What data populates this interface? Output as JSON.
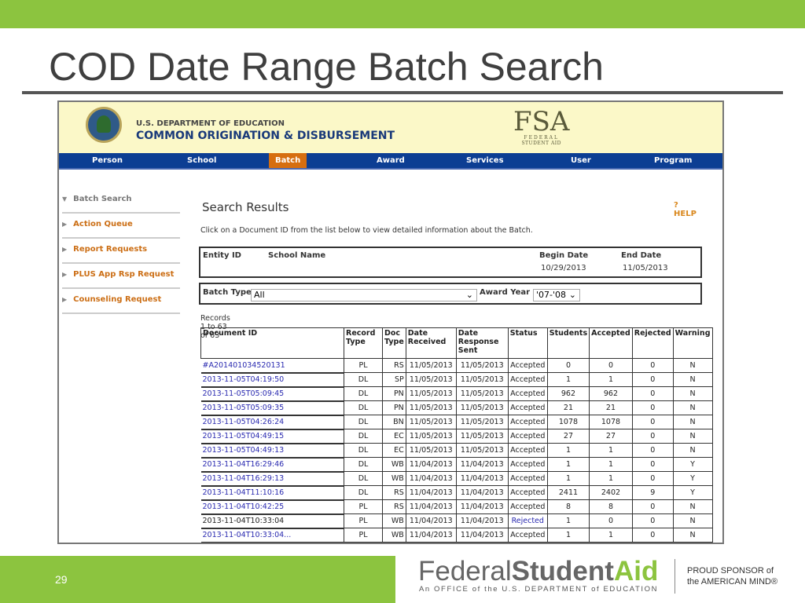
{
  "slide": {
    "title": "COD Date Range Batch Search",
    "page_number": "29",
    "colors": {
      "green": "#8cc43f",
      "nav_blue": "#0c3e93",
      "active_orange": "#d66e10"
    }
  },
  "header": {
    "dept": "U.S. DEPARTMENT OF EDUCATION",
    "system": "COMMON ORIGINATION & DISBURSEMENT",
    "fsa_logo": "FSA",
    "fsa_sub1": "FEDERAL",
    "fsa_sub2": "STUDENT AID"
  },
  "nav": [
    "Person",
    "School",
    "Batch",
    "Award",
    "Services",
    "User",
    "Program"
  ],
  "sidebar": [
    "Batch Search",
    "Action Queue",
    "Report Requests",
    "PLUS App Rsp Request",
    "Counseling Request"
  ],
  "main": {
    "heading": "Search Results",
    "help": "HELP",
    "instructions": "Click on a Document ID from the list below to view detailed information about the Batch.",
    "entity_label": "Entity ID",
    "school_label": "School Name",
    "begin_label": "Begin Date",
    "end_label": "End Date",
    "begin_date": "10/29/2013",
    "end_date": "11/05/2013",
    "batch_type_label": "Batch Type",
    "batch_type_value": "All",
    "award_year_label": "Award Year",
    "award_year_value": "'07-'08",
    "records": "Records 1 to 63 of 63"
  },
  "table": {
    "headers": [
      "Document ID",
      "Record Type",
      "Doc Type",
      "Date Received",
      "Date Response Sent",
      "Status",
      "Students",
      "Accepted",
      "Rejected",
      "Warning"
    ],
    "rows": [
      [
        "#A201401034520131",
        "PL",
        "RS",
        "11/05/2013",
        "11/05/2013",
        "Accepted",
        "0",
        "0",
        "0",
        "N"
      ],
      [
        "2013-11-05T04:19:50",
        "DL",
        "SP",
        "11/05/2013",
        "11/05/2013",
        "Accepted",
        "1",
        "1",
        "0",
        "N"
      ],
      [
        "2013-11-05T05:09:45",
        "DL",
        "PN",
        "11/05/2013",
        "11/05/2013",
        "Accepted",
        "962",
        "962",
        "0",
        "N"
      ],
      [
        "2013-11-05T05:09:35",
        "DL",
        "PN",
        "11/05/2013",
        "11/05/2013",
        "Accepted",
        "21",
        "21",
        "0",
        "N"
      ],
      [
        "2013-11-05T04:26:24",
        "DL",
        "BN",
        "11/05/2013",
        "11/05/2013",
        "Accepted",
        "1078",
        "1078",
        "0",
        "N"
      ],
      [
        "2013-11-05T04:49:15",
        "DL",
        "EC",
        "11/05/2013",
        "11/05/2013",
        "Accepted",
        "27",
        "27",
        "0",
        "N"
      ],
      [
        "2013-11-05T04:49:13",
        "DL",
        "EC",
        "11/05/2013",
        "11/05/2013",
        "Accepted",
        "1",
        "1",
        "0",
        "N"
      ],
      [
        "2013-11-04T16:29:46",
        "DL",
        "WB",
        "11/04/2013",
        "11/04/2013",
        "Accepted",
        "1",
        "1",
        "0",
        "Y"
      ],
      [
        "2013-11-04T16:29:13",
        "DL",
        "WB",
        "11/04/2013",
        "11/04/2013",
        "Accepted",
        "1",
        "1",
        "0",
        "Y"
      ],
      [
        "2013-11-04T11:10:16",
        "DL",
        "RS",
        "11/04/2013",
        "11/04/2013",
        "Accepted",
        "2411",
        "2402",
        "9",
        "Y"
      ],
      [
        "2013-11-04T10:42:25",
        "PL",
        "RS",
        "11/04/2013",
        "11/04/2013",
        "Accepted",
        "8",
        "8",
        "0",
        "N"
      ],
      [
        "2013-11-04T10:33:04",
        "PL",
        "WB",
        "11/04/2013",
        "11/04/2013",
        "Rejected",
        "1",
        "0",
        "0",
        "N"
      ],
      [
        "2013-11-04T10:33:04...",
        "PL",
        "WB",
        "11/04/2013",
        "11/04/2013",
        "Accepted",
        "1",
        "1",
        "0",
        "N"
      ]
    ]
  },
  "footer": {
    "brand1": "Federal",
    "brand2": "Student",
    "brand3": "Aid",
    "office": "An OFFICE of the U.S. DEPARTMENT of EDUCATION",
    "proud1": "PROUD SPONSOR of",
    "proud2": "the AMERICAN MIND®"
  }
}
